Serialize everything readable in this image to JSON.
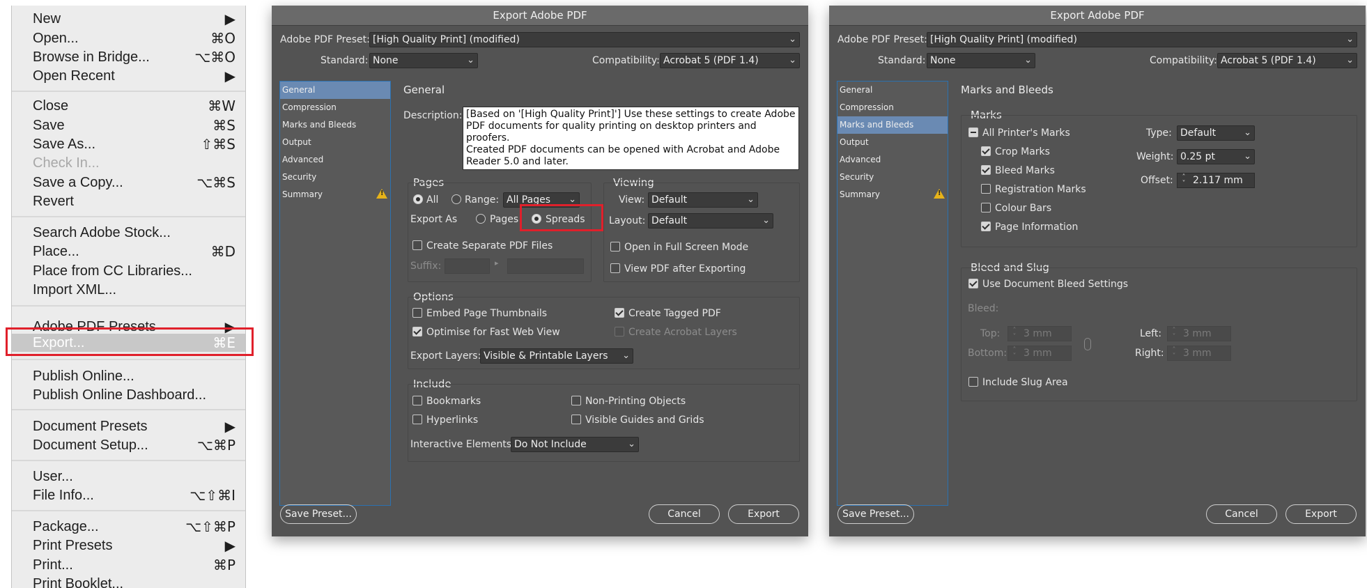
{
  "file_menu": {
    "items": [
      {
        "label": "New",
        "shortcut": "▶"
      },
      {
        "label": "Open...",
        "shortcut": "⌘O"
      },
      {
        "label": "Browse in Bridge...",
        "shortcut": "⌥⌘O"
      },
      {
        "label": "Open Recent",
        "shortcut": "▶"
      },
      {
        "label": "Close",
        "shortcut": "⌘W"
      },
      {
        "label": "Save",
        "shortcut": "⌘S"
      },
      {
        "label": "Save As...",
        "shortcut": "⇧⌘S"
      },
      {
        "label": "Check In...",
        "shortcut": ""
      },
      {
        "label": "Save a Copy...",
        "shortcut": "⌥⌘S"
      },
      {
        "label": "Revert",
        "shortcut": ""
      },
      {
        "label": "Search Adobe Stock...",
        "shortcut": ""
      },
      {
        "label": "Place...",
        "shortcut": "⌘D"
      },
      {
        "label": "Place from CC Libraries...",
        "shortcut": ""
      },
      {
        "label": "Import XML...",
        "shortcut": ""
      },
      {
        "label": "Adobe PDF Presets",
        "shortcut": "▶"
      },
      {
        "label": "Export...",
        "shortcut": "⌘E"
      },
      {
        "label": "Publish Online...",
        "shortcut": ""
      },
      {
        "label": "Publish Online Dashboard...",
        "shortcut": ""
      },
      {
        "label": "Document Presets",
        "shortcut": "▶"
      },
      {
        "label": "Document Setup...",
        "shortcut": "⌥⌘P"
      },
      {
        "label": "User...",
        "shortcut": ""
      },
      {
        "label": "File Info...",
        "shortcut": "⌥⇧⌘I"
      },
      {
        "label": "Package...",
        "shortcut": "⌥⇧⌘P"
      },
      {
        "label": "Print Presets",
        "shortcut": "▶"
      },
      {
        "label": "Print...",
        "shortcut": "⌘P"
      },
      {
        "label": "Print Booklet...",
        "shortcut": ""
      }
    ]
  },
  "dialog_title": "Export Adobe PDF",
  "header": {
    "preset_label": "Adobe PDF Preset:",
    "preset_value": "[High Quality Print] (modified)",
    "standard_label": "Standard:",
    "standard_value": "None",
    "compat_label": "Compatibility:",
    "compat_value": "Acrobat 5 (PDF 1.4)"
  },
  "sidebar": {
    "items": [
      "General",
      "Compression",
      "Marks and Bleeds",
      "Output",
      "Advanced",
      "Security",
      "Summary"
    ],
    "warning_icon": "warning-triangle-icon"
  },
  "buttons": {
    "save_preset": "Save Preset...",
    "cancel": "Cancel",
    "export": "Export"
  },
  "general": {
    "title": "General",
    "description_label": "Description:",
    "description": "[Based on '[High Quality Print]'] Use these settings to create Adobe\nPDF documents for quality printing on desktop printers and proofers.\nCreated PDF documents can be opened with Acrobat and Adobe\nReader 5.0 and later.",
    "pages": {
      "title": "Pages",
      "all": "All",
      "range": "Range:",
      "range_value": "All Pages",
      "export_as": "Export As",
      "pages_opt": "Pages",
      "spreads_opt": "Spreads",
      "separate": "Create Separate PDF Files",
      "suffix": "Suffix:"
    },
    "viewing": {
      "title": "Viewing",
      "view_label": "View:",
      "view_value": "Default",
      "layout_label": "Layout:",
      "layout_value": "Default",
      "fullscreen": "Open in Full Screen Mode",
      "view_after": "View PDF after Exporting"
    },
    "options": {
      "title": "Options",
      "thumbs": "Embed Page Thumbnails",
      "tagged": "Create Tagged PDF",
      "optimise": "Optimise for Fast Web View",
      "acrobat_layers": "Create Acrobat Layers",
      "export_layers_label": "Export Layers:",
      "export_layers_value": "Visible & Printable Layers"
    },
    "include": {
      "title": "Include",
      "bookmarks": "Bookmarks",
      "nonprinting": "Non-Printing Objects",
      "hyperlinks": "Hyperlinks",
      "guides": "Visible Guides and Grids",
      "interactive_label": "Interactive Elements:",
      "interactive_value": "Do Not Include"
    }
  },
  "marks": {
    "title": "Marks and Bleeds",
    "marks_group": "Marks",
    "all_marks": "All Printer's Marks",
    "crop": "Crop Marks",
    "bleed_marks": "Bleed Marks",
    "registration": "Registration Marks",
    "colour_bars": "Colour Bars",
    "page_info": "Page Information",
    "type_label": "Type:",
    "type_value": "Default",
    "weight_label": "Weight:",
    "weight_value": "0.25 pt",
    "offset_label": "Offset:",
    "offset_value": "2.117 mm",
    "bleed_slug_group": "Bleed and Slug",
    "use_doc_bleed": "Use Document Bleed Settings",
    "bleed_label": "Bleed:",
    "top_label": "Top:",
    "bottom_label": "Bottom:",
    "left_label": "Left:",
    "right_label": "Right:",
    "top_value": "3 mm",
    "bottom_value": "3 mm",
    "left_value": "3 mm",
    "right_value": "3 mm",
    "slug": "Include Slug Area"
  }
}
